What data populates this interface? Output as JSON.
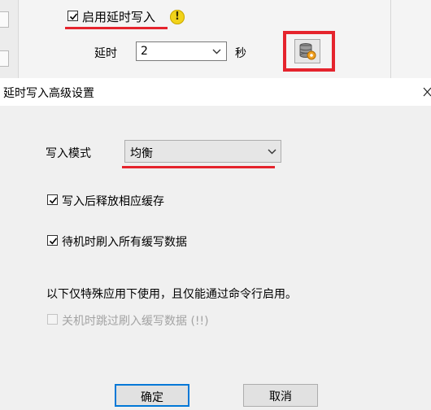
{
  "background_panel": {
    "enable_delayed_write_label": "启用延时写入",
    "enable_delayed_write_checked": true,
    "warning_icon": "warning-icon",
    "delay_label": "延时",
    "delay_value": "2",
    "delay_unit": "秒",
    "cache_button_icon": "disk-cache-settings-icon"
  },
  "dialog": {
    "title": "延时写入高级设置",
    "close_icon": "close-icon",
    "write_mode_label": "写入模式",
    "write_mode_value": "均衡",
    "release_cache_label": "写入后释放相应缓存",
    "release_cache_checked": true,
    "flush_on_idle_label": "待机时刷入所有缓写数据",
    "flush_on_idle_checked": true,
    "special_note": "以下仅特殊应用下使用，且仅能通过命令行启用。",
    "skip_flush_label": "关机时跳过刷入缓写数据 (!!)",
    "skip_flush_checked": false,
    "skip_flush_enabled": false,
    "ok_label": "确定",
    "cancel_label": "取消"
  },
  "colors": {
    "highlight_red": "#e5242d",
    "default_button_border": "#0078d7",
    "dialog_bg": "#f0f0f0"
  }
}
